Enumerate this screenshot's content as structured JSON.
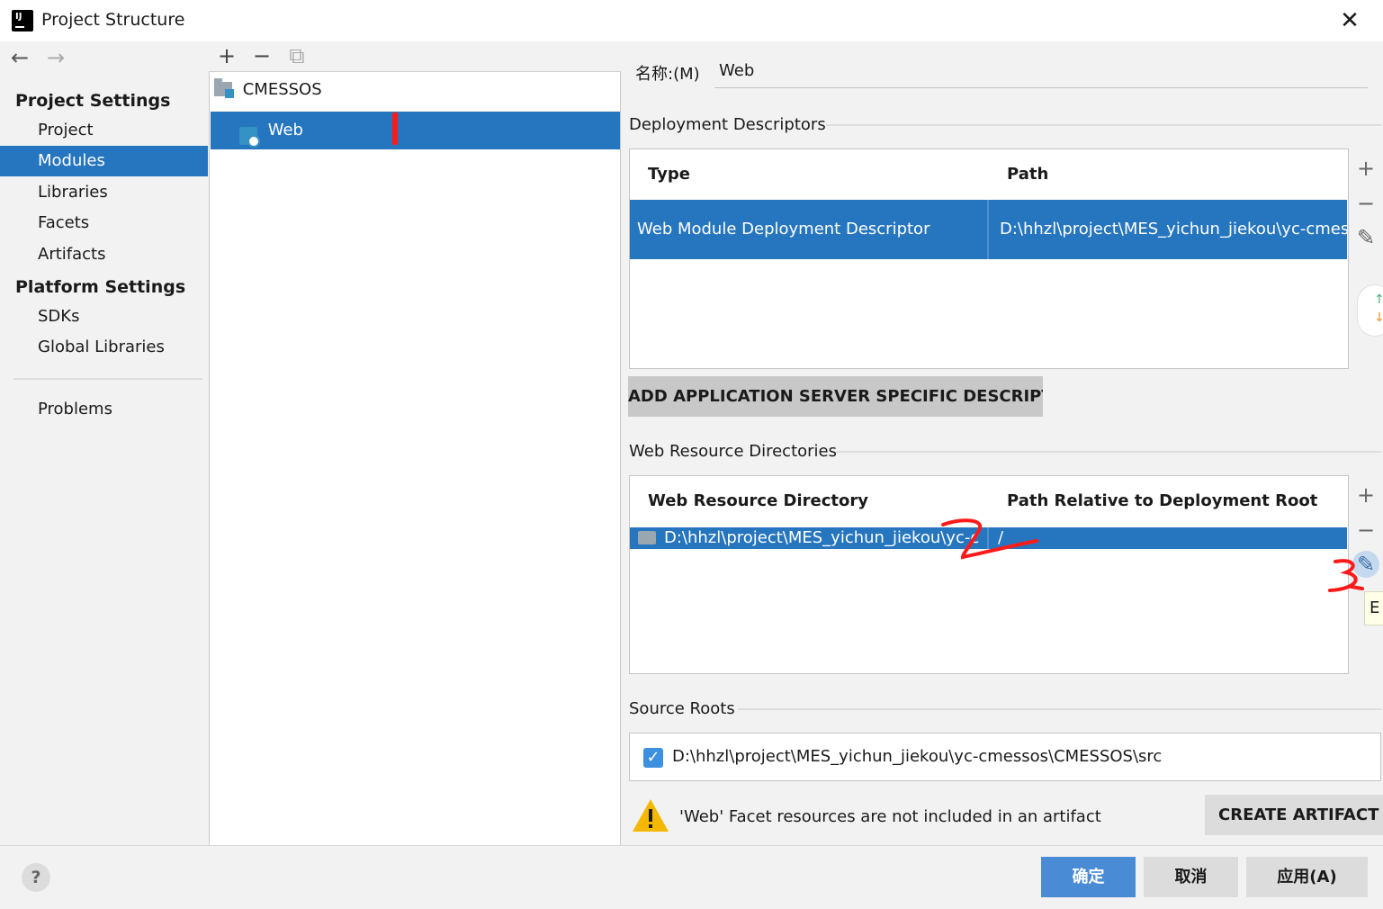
{
  "window": {
    "title": "Project Structure",
    "close_glyph": "✕"
  },
  "nav": {
    "back": "←",
    "forward": "→"
  },
  "sidebar": {
    "project_settings_heading": "Project Settings",
    "project_items": [
      "Project",
      "Modules",
      "Libraries",
      "Facets",
      "Artifacts"
    ],
    "platform_settings_heading": "Platform Settings",
    "platform_items": [
      "SDKs",
      "Global Libraries"
    ],
    "problems": "Problems",
    "selected": "Modules"
  },
  "tree": {
    "toolbar": {
      "add": "+",
      "remove": "−",
      "copy": "⧉"
    },
    "root": "CMESSOS",
    "child": "Web"
  },
  "module": {
    "name_label": "名称:(M)",
    "name_value": "Web"
  },
  "deployment_descriptors": {
    "title": "Deployment Descriptors",
    "columns": [
      "Type",
      "Path"
    ],
    "rows": [
      {
        "type": "Web Module Deployment Descriptor",
        "path": "D:\\hhzl\\project\\MES_yichun_jiekou\\yc-cmess"
      }
    ],
    "add_server_button": "ADD APPLICATION SERVER SPECIFIC DESCRIPTOR..."
  },
  "web_resources": {
    "title": "Web Resource Directories",
    "columns": [
      "Web Resource Directory",
      "Path Relative to Deployment Root"
    ],
    "rows": [
      {
        "directory": "D:\\hhzl\\project\\MES_yichun_jiekou\\yc-c...",
        "relative": "/"
      }
    ],
    "tooltip": "E"
  },
  "source_roots": {
    "title": "Source Roots",
    "items": [
      {
        "checked": true,
        "path": "D:\\hhzl\\project\\MES_yichun_jiekou\\yc-cmessos\\CMESSOS\\src"
      }
    ]
  },
  "warning": {
    "text": "'Web' Facet resources are not included in an artifact",
    "button": "CREATE ARTIFACT"
  },
  "side_tools": {
    "add": "+",
    "remove": "−",
    "edit": "✎"
  },
  "dialog_buttons": {
    "ok": "确定",
    "cancel": "取消",
    "apply": "应用(A)",
    "help": "?"
  },
  "annotations": [
    "2",
    "3"
  ],
  "colors": {
    "selection": "#2675bf",
    "ok_button": "#4a8bd6",
    "annotation": "#ff1a1a"
  }
}
